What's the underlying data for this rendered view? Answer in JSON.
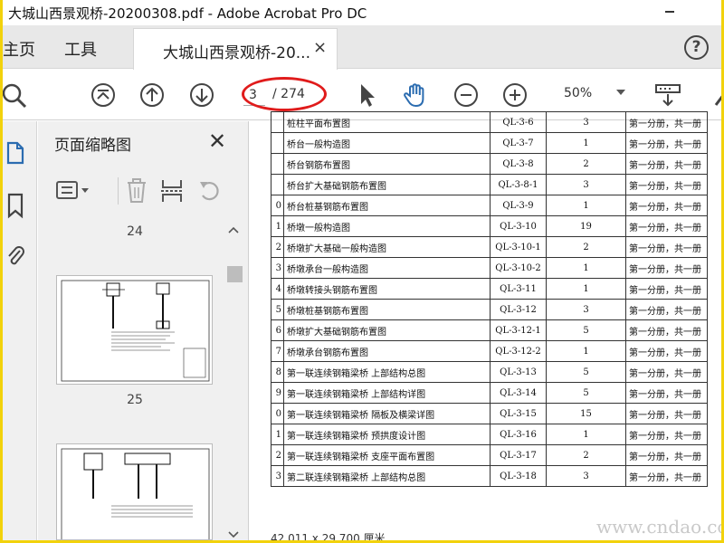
{
  "window": {
    "title": "大城山西景观桥-20200308.pdf - Adobe Acrobat Pro DC"
  },
  "tabs": {
    "home": "主页",
    "tools": "工具",
    "document": "大城山西景观桥-20...",
    "close_glyph": "×",
    "help_glyph": "?"
  },
  "toolbar": {
    "current_page": "3",
    "page_total": "/ 274",
    "zoom": "50%",
    "icons": [
      "search-icon",
      "first-page-icon",
      "prev-page-icon",
      "next-page-icon",
      "select-arrow-icon",
      "hand-tool-icon",
      "zoom-out-icon",
      "zoom-in-icon",
      "zoom-dropdown",
      "scroll-mode-icon"
    ]
  },
  "thumbnail_pane": {
    "title": "页面缩略图",
    "close_glyph": "✕",
    "page_labels": [
      "24",
      "25"
    ]
  },
  "document": {
    "rows": [
      {
        "idx": "",
        "name": "桩柱平面布置图",
        "code": "QL-3-6",
        "count": "3",
        "vol": "第一分册，共一册"
      },
      {
        "idx": "",
        "name": "桥台一般构造图",
        "code": "QL-3-7",
        "count": "1",
        "vol": "第一分册，共一册"
      },
      {
        "idx": "",
        "name": "桥台钢筋布置图",
        "code": "QL-3-8",
        "count": "2",
        "vol": "第一分册，共一册"
      },
      {
        "idx": "",
        "name": "桥台扩大基础钢筋布置图",
        "code": "QL-3-8-1",
        "count": "3",
        "vol": "第一分册，共一册"
      },
      {
        "idx": "0",
        "name": "桥台桩基钢筋布置图",
        "code": "QL-3-9",
        "count": "1",
        "vol": "第一分册，共一册"
      },
      {
        "idx": "1",
        "name": "桥墩一般构造图",
        "code": "QL-3-10",
        "count": "19",
        "vol": "第一分册，共一册"
      },
      {
        "idx": "2",
        "name": "桥墩扩大基础一般构造图",
        "code": "QL-3-10-1",
        "count": "2",
        "vol": "第一分册，共一册"
      },
      {
        "idx": "3",
        "name": "桥墩承台一般构造图",
        "code": "QL-3-10-2",
        "count": "1",
        "vol": "第一分册，共一册"
      },
      {
        "idx": "4",
        "name": "桥墩转接头钢筋布置图",
        "code": "QL-3-11",
        "count": "1",
        "vol": "第一分册，共一册"
      },
      {
        "idx": "5",
        "name": "桥墩桩基钢筋布置图",
        "code": "QL-3-12",
        "count": "3",
        "vol": "第一分册，共一册"
      },
      {
        "idx": "6",
        "name": "桥墩扩大基础钢筋布置图",
        "code": "QL-3-12-1",
        "count": "5",
        "vol": "第一分册，共一册"
      },
      {
        "idx": "7",
        "name": "桥墩承台钢筋布置图",
        "code": "QL-3-12-2",
        "count": "1",
        "vol": "第一分册，共一册"
      },
      {
        "idx": "8",
        "name": "第一联连续钢箱梁桥 上部结构总图",
        "code": "QL-3-13",
        "count": "5",
        "vol": "第一分册，共一册"
      },
      {
        "idx": "9",
        "name": "第一联连续钢箱梁桥 上部结构详图",
        "code": "QL-3-14",
        "count": "5",
        "vol": "第一分册，共一册"
      },
      {
        "idx": "0",
        "name": "第一联连续钢箱梁桥 隔板及横梁详图",
        "code": "QL-3-15",
        "count": "15",
        "vol": "第一分册，共一册"
      },
      {
        "idx": "1",
        "name": "第一联连续钢箱梁桥 预拱度设计图",
        "code": "QL-3-16",
        "count": "1",
        "vol": "第一分册，共一册"
      },
      {
        "idx": "2",
        "name": "第一联连续钢箱梁桥 支座平面布置图",
        "code": "QL-3-17",
        "count": "2",
        "vol": "第一分册，共一册"
      },
      {
        "idx": "3",
        "name": "第二联连续钢箱梁桥 上部结构总图",
        "code": "QL-3-18",
        "count": "3",
        "vol": "第一分册，共一册"
      }
    ],
    "status_text": "42.011 x 29.700 厘米",
    "watermark": "www.cndao.com"
  },
  "colors": {
    "outer_border": "#f2d20c",
    "annotation_red": "#e01b1b",
    "accent_blue": "#2b6cb0"
  }
}
